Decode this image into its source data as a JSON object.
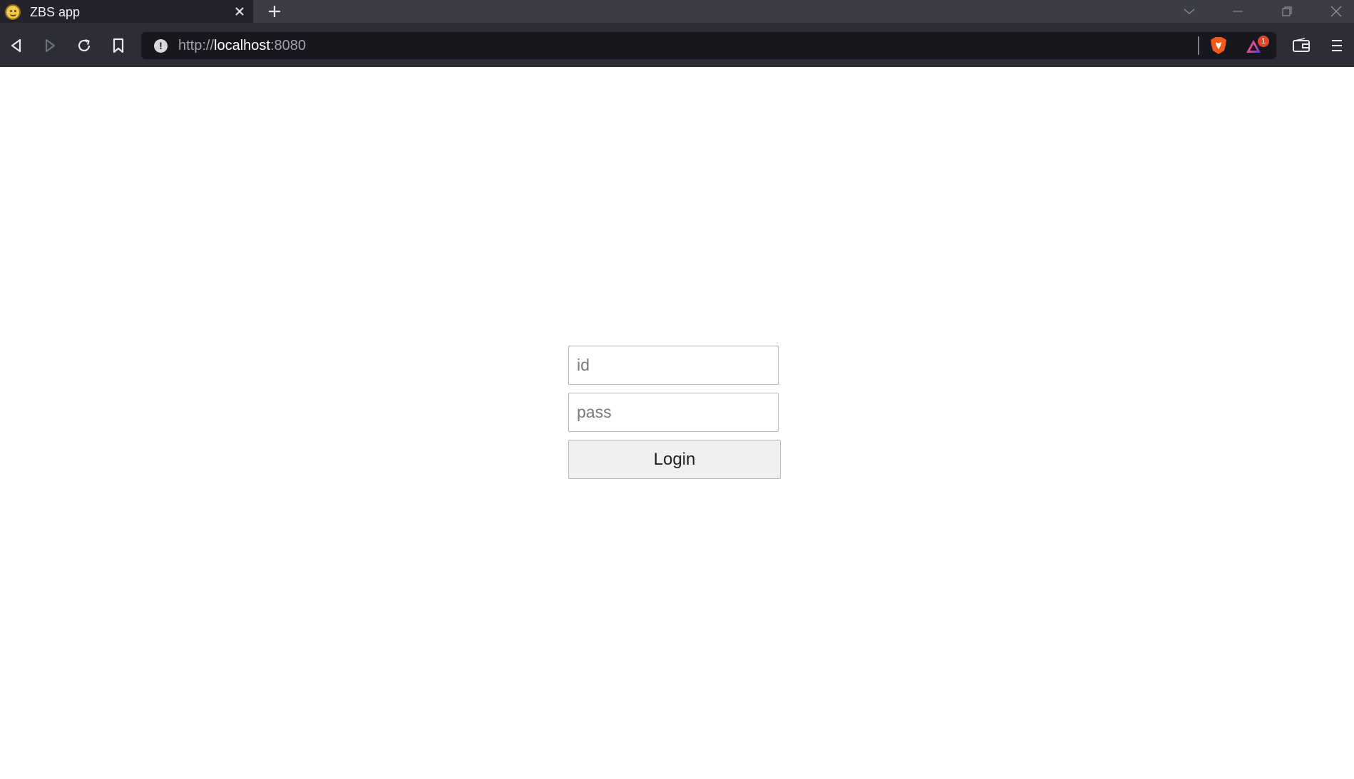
{
  "browser": {
    "tab": {
      "title": "ZBS app",
      "close_icon": "close-icon",
      "favicon": "smiley-favicon"
    },
    "new_tab_icon": "plus-icon",
    "window_controls": [
      "chevron-down-icon",
      "minimize-icon",
      "restore-icon",
      "close-icon"
    ],
    "url": {
      "scheme": "http://",
      "host": "localhost",
      "port": ":8080"
    },
    "rewards_badge": "1"
  },
  "login": {
    "id_placeholder": "id",
    "pass_placeholder": "pass",
    "button_label": "Login"
  }
}
